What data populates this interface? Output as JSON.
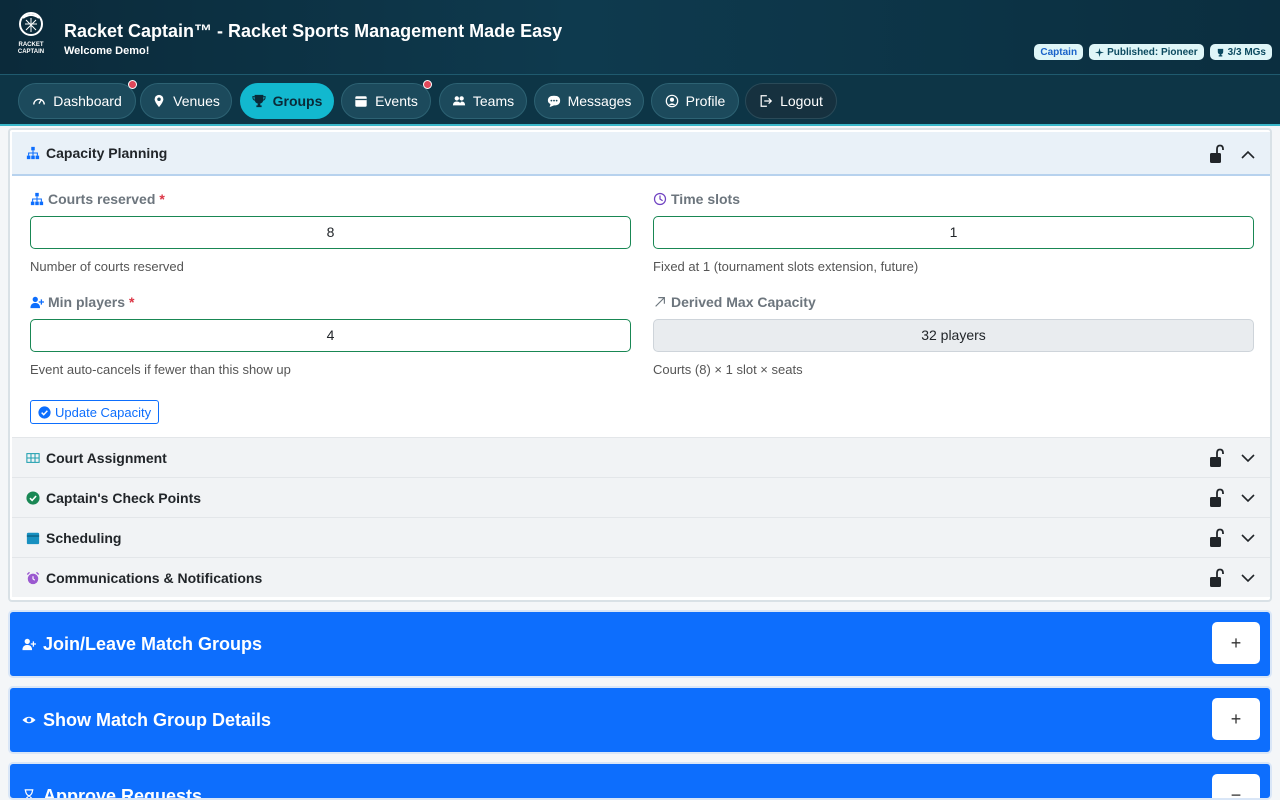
{
  "header": {
    "title": "Racket Captain™ - Racket Sports Management Made Easy",
    "welcome": "Welcome Demo!",
    "logo_text": "RACKET CAPTAIN",
    "badges": [
      {
        "label": "Captain",
        "icon": "none"
      },
      {
        "label": "Published: Pioneer",
        "icon": "sparkle-icon"
      },
      {
        "label": "3/3 MGs",
        "icon": "trophy-icon"
      }
    ]
  },
  "nav": {
    "items": [
      {
        "label": "Dashboard",
        "icon": "gauge-icon",
        "notify": true
      },
      {
        "label": "Venues",
        "icon": "map-pin-icon",
        "notify": false
      },
      {
        "label": "Groups",
        "icon": "trophy-icon",
        "notify": false,
        "active": true
      },
      {
        "label": "Events",
        "icon": "calendar-icon",
        "notify": true
      },
      {
        "label": "Teams",
        "icon": "people-icon",
        "notify": false
      },
      {
        "label": "Messages",
        "icon": "chat-icon",
        "notify": false
      },
      {
        "label": "Profile",
        "icon": "person-circle-icon",
        "notify": false
      },
      {
        "label": "Logout",
        "icon": "logout-icon",
        "notify": false
      }
    ]
  },
  "capacity": {
    "title": "Capacity Planning",
    "courts": {
      "label": "Courts reserved",
      "required": "*",
      "value": "8",
      "help": "Number of courts reserved"
    },
    "timeslots": {
      "label": "Time slots",
      "value": "1",
      "help": "Fixed at 1 (tournament slots extension, future)"
    },
    "min_players": {
      "label": "Min players",
      "required": "*",
      "value": "4",
      "help": "Event auto-cancels if fewer than this show up"
    },
    "max_capacity": {
      "label": "Derived Max Capacity",
      "value": "32 players",
      "help": "Courts (8) × 1 slot × seats"
    },
    "update_label": "Update Capacity"
  },
  "sections": [
    {
      "title": "Court Assignment",
      "icon": "grid-icon"
    },
    {
      "title": "Captain's Check Points",
      "icon": "check-circle-icon"
    },
    {
      "title": "Scheduling",
      "icon": "calendar-icon"
    },
    {
      "title": "Communications & Notifications",
      "icon": "alarm-icon"
    }
  ],
  "panels": [
    {
      "title": "Join/Leave Match Groups",
      "icon": "person-plus-icon",
      "toggle": "+"
    },
    {
      "title": "Show Match Group Details",
      "icon": "eye-icon",
      "toggle": "+"
    },
    {
      "title": "Approve Requests",
      "icon": "hourglass-icon",
      "toggle": "−"
    }
  ],
  "colors": {
    "primary": "#0d6efd",
    "accent": "#12b8cf",
    "header": "#0b2a3a",
    "success": "#198754"
  }
}
